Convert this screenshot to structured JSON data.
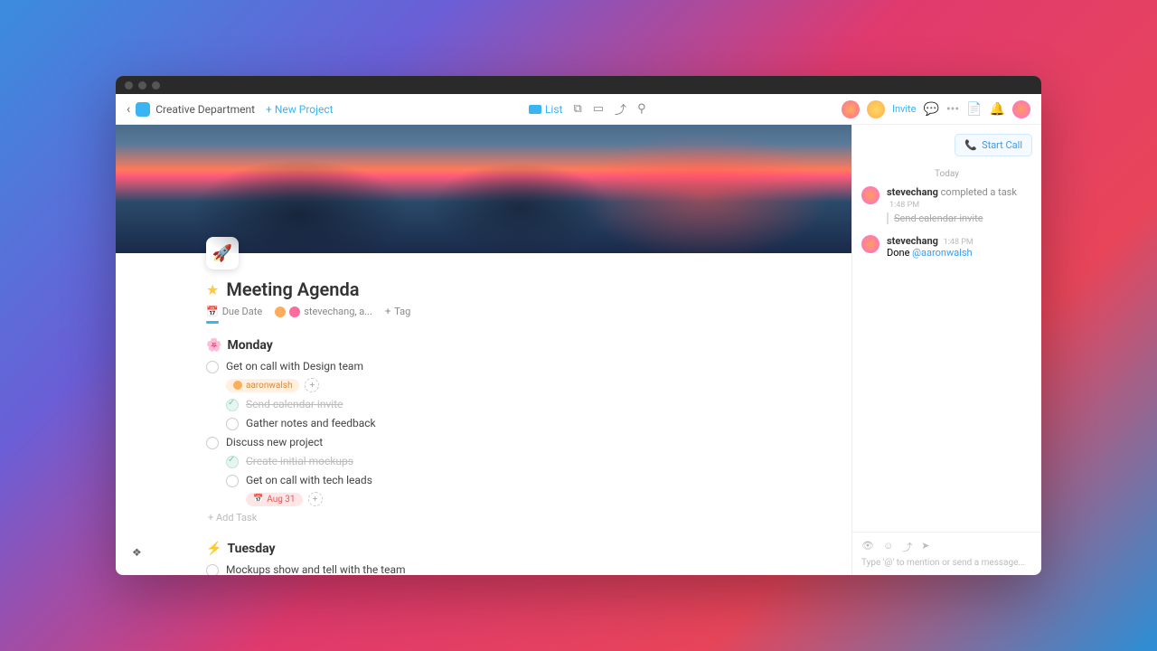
{
  "breadcrumb": "Creative Department",
  "new_project": "New Project",
  "view_label": "List",
  "invite": "Invite",
  "page": {
    "icon": "🚀",
    "title": "Meeting Agenda",
    "due_date": "Due Date",
    "assignees": "stevechang, a...",
    "tag": "Tag"
  },
  "sections": [
    {
      "emoji": "🌸",
      "title": "Monday",
      "tasks": [
        {
          "text": "Get on call with Design team",
          "done": false,
          "chips": [
            {
              "type": "user",
              "label": "aaronwalsh"
            }
          ],
          "subtasks": [
            {
              "text": "Send calendar invite",
              "done": true
            },
            {
              "text": "Gather notes and feedback",
              "done": false
            }
          ]
        },
        {
          "text": "Discuss new project",
          "done": false,
          "subtasks": [
            {
              "text": "Create initial mockups",
              "done": true
            },
            {
              "text": "Get on call with tech leads",
              "done": false,
              "chips": [
                {
                  "type": "date",
                  "label": "Aug 31"
                }
              ]
            }
          ]
        }
      ],
      "add_task": "Add Task"
    },
    {
      "emoji": "⚡",
      "title": "Tuesday",
      "tasks": [
        {
          "text": "Mockups show and tell with the team",
          "done": false
        }
      ]
    }
  ],
  "sidebar": {
    "call": "Start Call",
    "today": "Today",
    "feed": [
      {
        "user": "stevechang",
        "action": "completed a task",
        "time": "1:48 PM",
        "detail": "Send calendar invite",
        "detail_struck": true
      },
      {
        "user": "stevechang",
        "action": "",
        "time": "1:48 PM",
        "message": "Done",
        "mention": "@aaronwalsh"
      }
    ],
    "composer_placeholder": "Type '@' to mention or send a message..."
  }
}
